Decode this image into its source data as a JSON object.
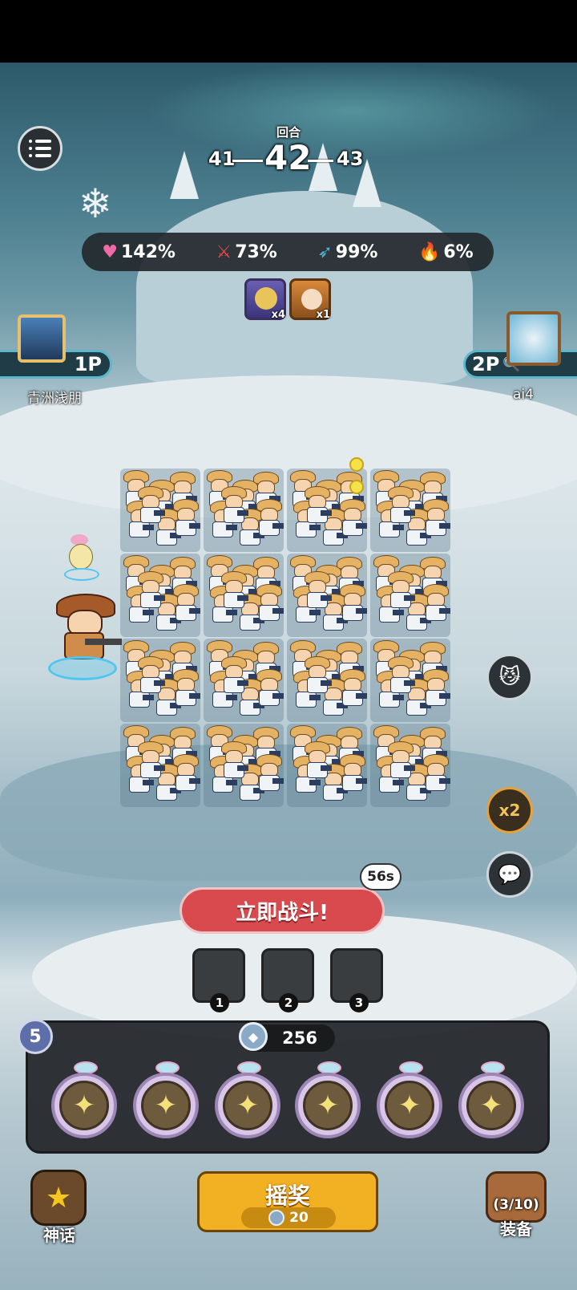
{
  "round": {
    "label": "回合",
    "prev": "41",
    "current": "42",
    "next": "43"
  },
  "stats": [
    {
      "icon": "heart-icon",
      "value": "142%",
      "color": "#f06aa8"
    },
    {
      "icon": "sword-icon",
      "value": "73%",
      "color": "#e44d4d"
    },
    {
      "icon": "wing-icon",
      "value": "99%",
      "color": "#4fb8d8"
    },
    {
      "icon": "fire-icon",
      "value": "6%",
      "color": "#f0902a"
    }
  ],
  "buffs": [
    {
      "icon": "buff-orb-icon",
      "count": "x4"
    },
    {
      "icon": "buff-king-icon",
      "count": "x1"
    }
  ],
  "player1": {
    "tag": "1P",
    "name": "青洲浅朋"
  },
  "player2": {
    "tag": "2P",
    "name": "ai4"
  },
  "timer": "56s",
  "fight_button": "立即战斗!",
  "slots": [
    "1",
    "2",
    "3"
  ],
  "level": "5",
  "gems": "256",
  "roll": {
    "label": "摇奖",
    "cost": "20"
  },
  "bottom": {
    "myth_label": "神话",
    "equip_label": "装备",
    "equip_count": "(3/10)"
  },
  "side_buttons": {
    "speed": "x2"
  },
  "colors": {
    "fight": "#d94a4f",
    "roll": "#f2b122",
    "accent": "#5cb8c9"
  }
}
